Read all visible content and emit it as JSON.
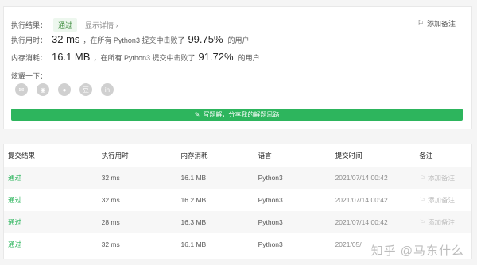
{
  "summary": {
    "result_label": "执行结果：",
    "result_badge": "通过",
    "detail_link": "显示详情 ›",
    "add_note": "添加备注",
    "runtime": {
      "label": "执行用时：",
      "value": "32 ms",
      "mid": "，在所有 Python3 提交中击败了",
      "pct": "99.75%",
      "suffix": "的用户"
    },
    "memory": {
      "label": "内存消耗：",
      "value": "16.1 MB",
      "mid": "，在所有 Python3 提交中击败了",
      "pct": "91.72%",
      "suffix": "的用户"
    },
    "share_label": "炫耀一下：",
    "share_icons": [
      {
        "name": "wechat-icon",
        "glyph": "✉"
      },
      {
        "name": "weibo-icon",
        "glyph": "◉"
      },
      {
        "name": "qq-icon",
        "glyph": "●"
      },
      {
        "name": "douban-icon",
        "glyph": "豆"
      },
      {
        "name": "linkedin-icon",
        "glyph": "in"
      }
    ],
    "solution_button": "写题解，分享我的解题思路"
  },
  "table": {
    "headers": [
      "提交结果",
      "执行用时",
      "内存消耗",
      "语言",
      "提交时间",
      "备注"
    ],
    "rows": [
      {
        "status": "通过",
        "runtime": "32 ms",
        "memory": "16.1 MB",
        "language": "Python3",
        "time": "2021/07/14 00:42",
        "note": "添加备注"
      },
      {
        "status": "通过",
        "runtime": "32 ms",
        "memory": "16.2 MB",
        "language": "Python3",
        "time": "2021/07/14 00:42",
        "note": "添加备注"
      },
      {
        "status": "通过",
        "runtime": "28 ms",
        "memory": "16.3 MB",
        "language": "Python3",
        "time": "2021/07/14 00:42",
        "note": "添加备注"
      },
      {
        "status": "通过",
        "runtime": "32 ms",
        "memory": "16.1 MB",
        "language": "Python3",
        "time": "2021/05/",
        "note": ""
      }
    ]
  },
  "watermark": "知乎 @马东什么",
  "colors": {
    "accent_green": "#2db55d",
    "pass_text": "#2db55d"
  }
}
